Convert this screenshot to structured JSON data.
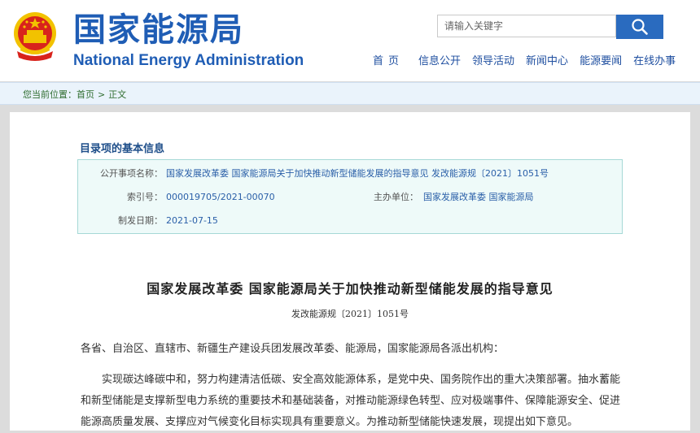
{
  "header": {
    "cn_title": "国家能源局",
    "en_title": "National Energy Administration",
    "search": {
      "placeholder": "请输入关键字"
    },
    "nav": [
      "首页",
      "信息公开",
      "领导活动",
      "新闻中心",
      "能源要闻",
      "在线办事"
    ]
  },
  "breadcrumb": {
    "prefix": "您当前位置：",
    "items": [
      "首页",
      "正文"
    ],
    "separator": ">"
  },
  "meta": {
    "heading": "目录项的基本信息",
    "public_item_label": "公开事项名称：",
    "public_item_value": "国家发展改革委 国家能源局关于加快推动新型储能发展的指导意见 发改能源规〔2021〕1051号",
    "index_label": "索引号：",
    "index_value": "000019705/2021-00070",
    "host_label": "主办单位：",
    "host_value": "国家发展改革委 国家能源局",
    "date_label": "制发日期：",
    "date_value": "2021-07-15"
  },
  "document": {
    "title": "国家发展改革委 国家能源局关于加快推动新型储能发展的指导意见",
    "number": "发改能源规〔2021〕1051号",
    "addressee": "各省、自治区、直辖市、新疆生产建设兵团发展改革委、能源局，国家能源局各派出机构：",
    "paragraph": "实现碳达峰碳中和，努力构建清洁低碳、安全高效能源体系，是党中央、国务院作出的重大决策部署。抽水蓄能和新型储能是支撑新型电力系统的重要技术和基础装备，对推动能源绿色转型、应对极端事件、保障能源安全、促进能源高质量发展、支撑应对气候变化目标实现具有重要意义。为推动新型储能快速发展，现提出如下意见。"
  },
  "colors": {
    "brand_blue": "#1f5db5",
    "search_button": "#2a6bbf",
    "breadcrumb_bg": "#eaf3fb",
    "meta_box_bg": "#eefaf9",
    "emblem_red": "#d8231c",
    "emblem_gold": "#f2c200"
  },
  "icons": {
    "search": "search-icon",
    "emblem": "national-emblem-icon"
  }
}
